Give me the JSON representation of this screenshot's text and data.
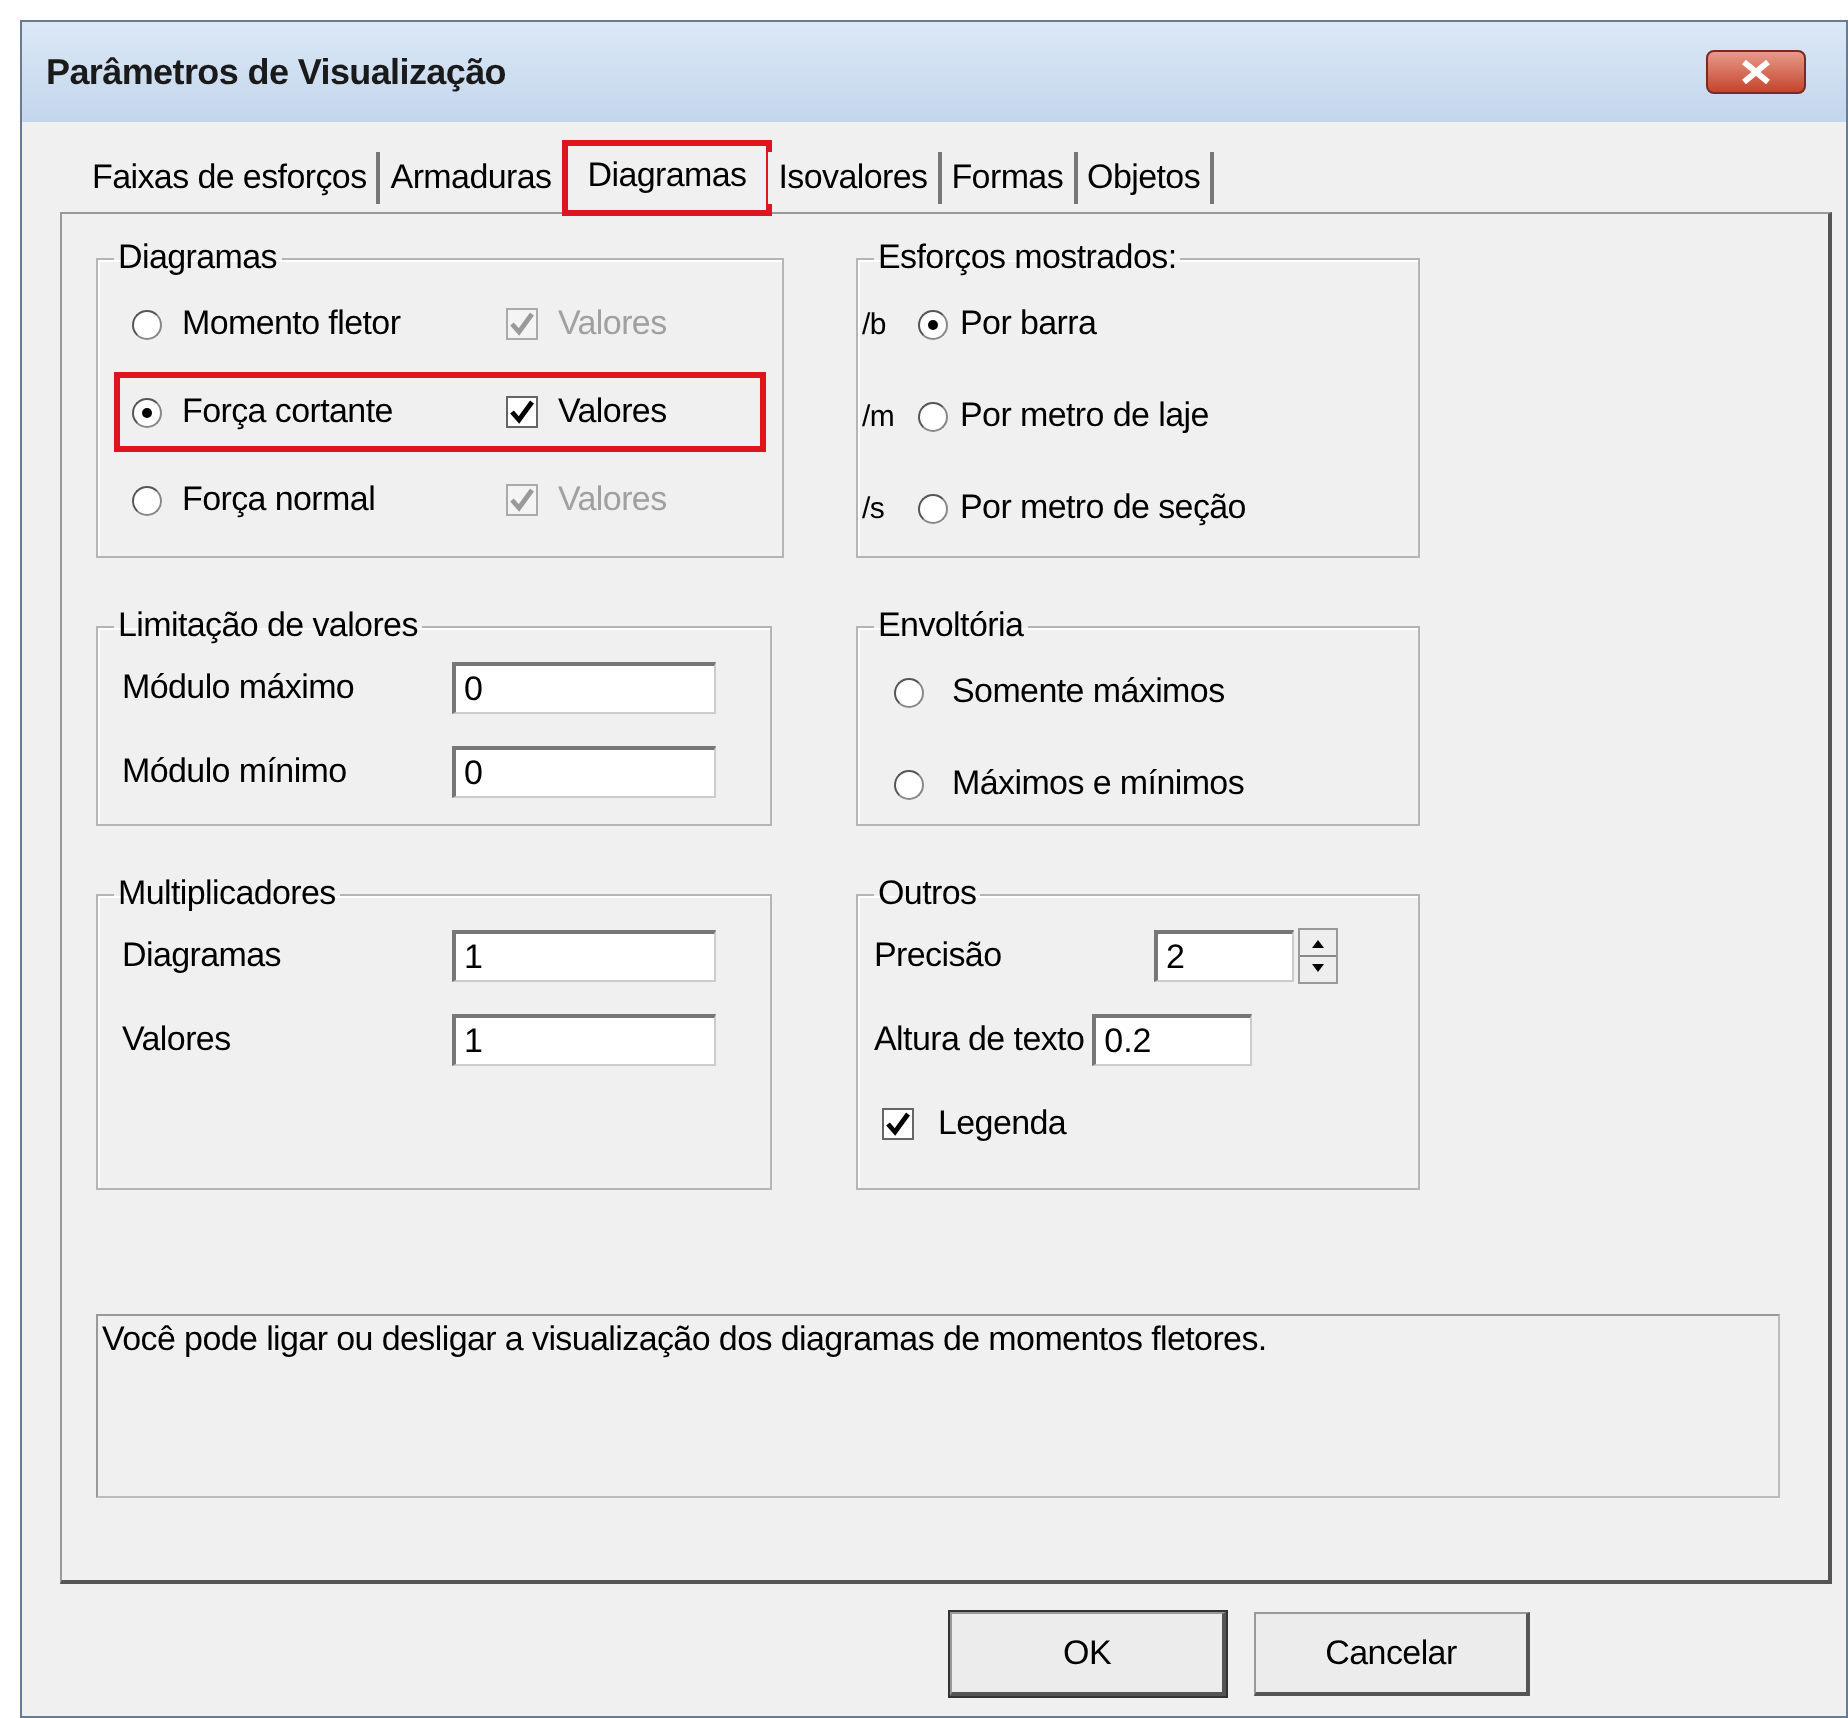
{
  "window": {
    "title": "Parâmetros de Visualização"
  },
  "tabs": [
    {
      "label": "Faixas de esforços",
      "selected": false,
      "highlighted": false
    },
    {
      "label": "Armaduras",
      "selected": false,
      "highlighted": false
    },
    {
      "label": "Diagramas",
      "selected": true,
      "highlighted": true
    },
    {
      "label": "Isovalores",
      "selected": false,
      "highlighted": false
    },
    {
      "label": "Formas",
      "selected": false,
      "highlighted": false
    },
    {
      "label": "Objetos",
      "selected": false,
      "highlighted": false
    }
  ],
  "diagramas": {
    "title": "Diagramas",
    "rows": [
      {
        "label": "Momento fletor",
        "selected": false,
        "highlighted": false,
        "values_label": "Valores",
        "values_checked": true,
        "values_disabled": true
      },
      {
        "label": "Força cortante",
        "selected": true,
        "highlighted": true,
        "values_label": "Valores",
        "values_checked": true,
        "values_disabled": false
      },
      {
        "label": "Força normal",
        "selected": false,
        "highlighted": false,
        "values_label": "Valores",
        "values_checked": true,
        "values_disabled": true
      }
    ]
  },
  "esforcos": {
    "title": "Esforços mostrados:",
    "rows": [
      {
        "prefix": "/b",
        "label": "Por barra",
        "selected": true
      },
      {
        "prefix": "/m",
        "label": "Por metro de laje",
        "selected": false
      },
      {
        "prefix": "/s",
        "label": "Por metro de seção",
        "selected": false
      }
    ]
  },
  "limitacao": {
    "title": "Limitação de valores",
    "fields": [
      {
        "label": "Módulo máximo",
        "value": "0"
      },
      {
        "label": "Módulo mínimo",
        "value": "0"
      }
    ]
  },
  "envoltoria": {
    "title": "Envoltória",
    "options": [
      {
        "label": "Somente máximos",
        "selected": false
      },
      {
        "label": "Máximos e mínimos",
        "selected": false
      }
    ]
  },
  "multiplicadores": {
    "title": "Multiplicadores",
    "fields": [
      {
        "label": "Diagramas",
        "value": "1"
      },
      {
        "label": "Valores",
        "value": "1"
      }
    ]
  },
  "outros": {
    "title": "Outros",
    "precisao": {
      "label": "Precisão",
      "value": "2"
    },
    "altura": {
      "label": "Altura de texto",
      "value": "0.2"
    },
    "legenda": {
      "label": "Legenda",
      "checked": true
    }
  },
  "description": "Você pode ligar ou desligar a visualização dos diagramas de momentos fletores.",
  "buttons": [
    {
      "label": "OK",
      "default": true
    },
    {
      "label": "Cancelar",
      "default": false
    }
  ]
}
